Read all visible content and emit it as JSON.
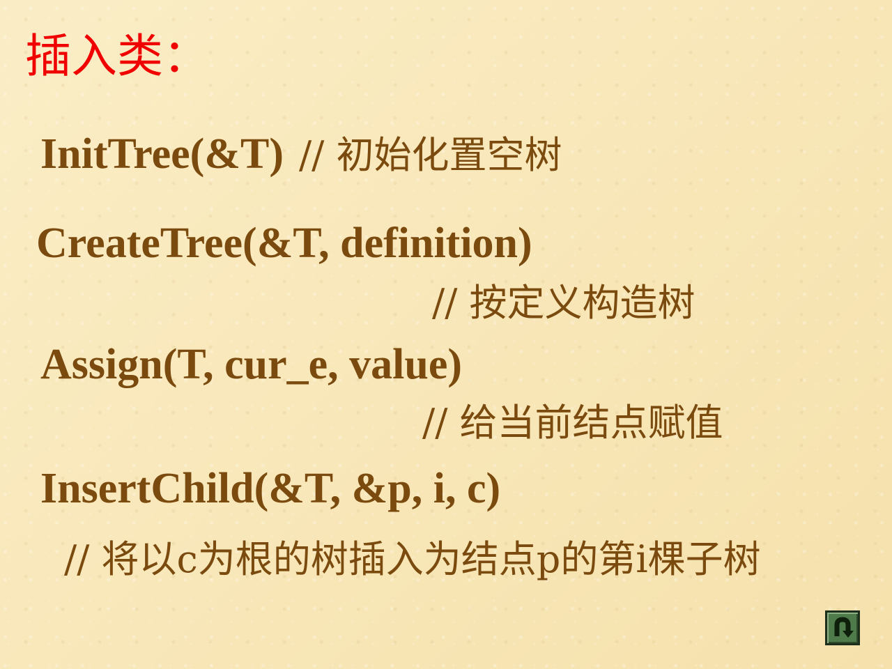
{
  "title": "插入类：",
  "lines": {
    "init_code": "InitTree(&T)",
    "init_comment": "// 初始化置空树",
    "create_code": "CreateTree(&T, definition)",
    "create_comment": "// 按定义构造树",
    "assign_code": "Assign(T, cur_e, value)",
    "assign_comment": "// 给当前结点赋值",
    "insert_code": "InsertChild(&T, &p, i, c)",
    "insert_comment": "// 将以c为根的树插入为结点p的第i棵子树"
  },
  "nav": {
    "return_icon": "return-arrow-icon"
  },
  "colors": {
    "title": "#f00000",
    "text": "#7a4a0e",
    "background": "#f8e6b4",
    "button": "#4f7a4a"
  }
}
